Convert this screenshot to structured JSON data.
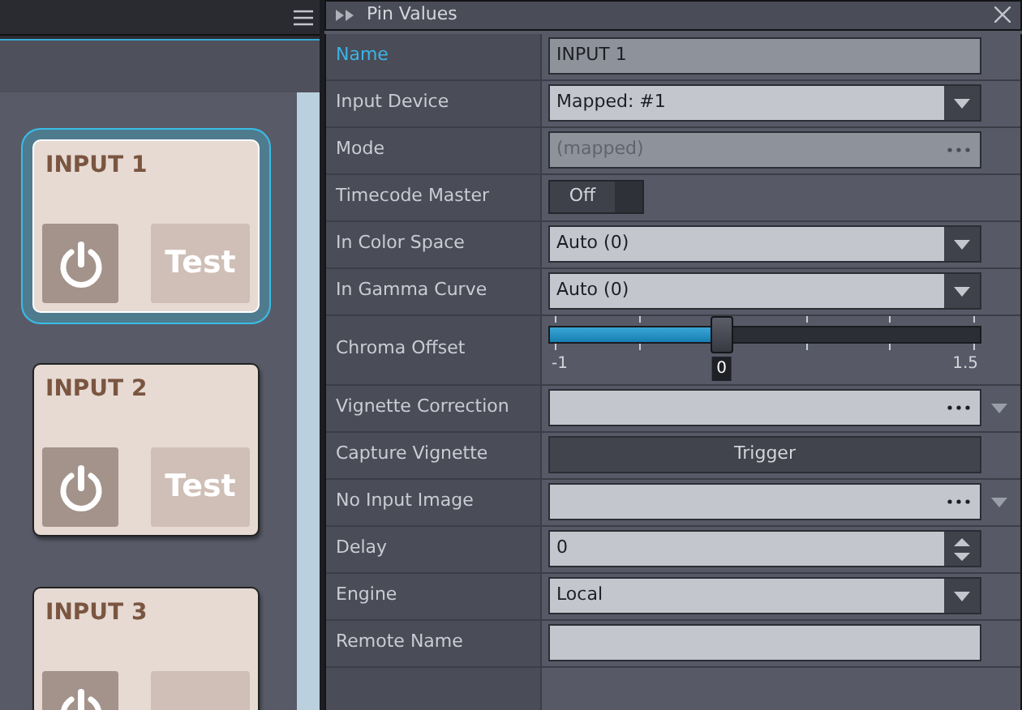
{
  "left_panel": {
    "cards": [
      {
        "title": "INPUT 1",
        "selected": true,
        "test_label": "Test"
      },
      {
        "title": "INPUT 2",
        "selected": false,
        "test_label": "Test"
      },
      {
        "title": "INPUT 3",
        "selected": false
      }
    ]
  },
  "pin_values": {
    "title": "Pin Values",
    "rows": [
      {
        "label": "Name",
        "kind": "text",
        "value": "INPUT 1",
        "selected": true
      },
      {
        "label": "Input Device",
        "kind": "dropdown",
        "value": "Mapped: #1",
        "selected": false
      },
      {
        "label": "Mode",
        "kind": "browse",
        "value": "(mapped)",
        "selected": false,
        "disabled": true
      },
      {
        "label": "Timecode Master",
        "kind": "toggle",
        "value": "Off",
        "on": false,
        "selected": false
      },
      {
        "label": "In Color Space",
        "kind": "dropdown",
        "value": "Auto (0)",
        "selected": false
      },
      {
        "label": "In Gamma Curve",
        "kind": "dropdown",
        "value": "Auto (0)",
        "selected": false
      },
      {
        "label": "Chroma Offset",
        "kind": "slider",
        "level": 0.4,
        "min_label": "-1",
        "value": "0",
        "max_label": "1.5",
        "selected": false
      },
      {
        "label": "Vignette Correction",
        "kind": "file",
        "selected": false
      },
      {
        "label": "Capture Vignette",
        "kind": "button",
        "value": "Trigger",
        "selected": false
      },
      {
        "label": "No Input Image",
        "kind": "file",
        "selected": false
      },
      {
        "label": "Delay",
        "kind": "spinner",
        "value": "0",
        "selected": false
      },
      {
        "label": "Engine",
        "kind": "dropdown",
        "value": "Local",
        "selected": false
      },
      {
        "label": "Remote Name",
        "kind": "text",
        "selected": false
      }
    ]
  }
}
